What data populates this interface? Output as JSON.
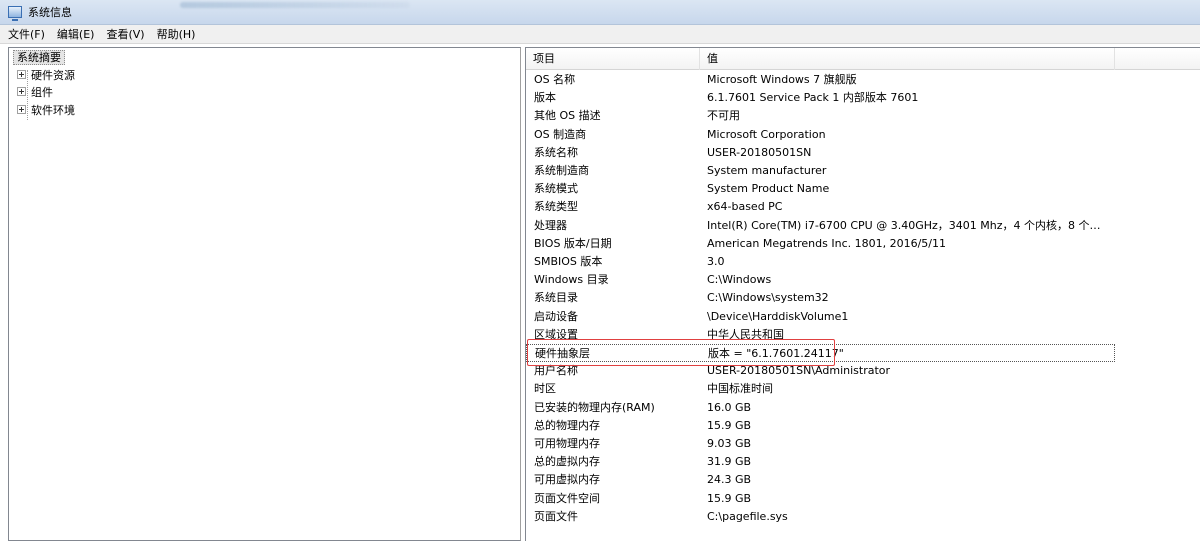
{
  "window": {
    "title": "系统信息"
  },
  "menu": [
    {
      "label": "文件(F)"
    },
    {
      "label": "编辑(E)"
    },
    {
      "label": "查看(V)"
    },
    {
      "label": "帮助(H)"
    }
  ],
  "tree": {
    "root": "系统摘要",
    "children": [
      {
        "label": "硬件资源"
      },
      {
        "label": "组件"
      },
      {
        "label": "软件环境"
      }
    ]
  },
  "list": {
    "columns": {
      "item": "项目",
      "value": "值"
    },
    "rows": [
      {
        "item": "OS 名称",
        "value": "Microsoft Windows 7 旗舰版"
      },
      {
        "item": "版本",
        "value": "6.1.7601 Service Pack 1 内部版本 7601"
      },
      {
        "item": "其他 OS 描述",
        "value": "不可用"
      },
      {
        "item": "OS 制造商",
        "value": "Microsoft Corporation"
      },
      {
        "item": "系统名称",
        "value": "USER-20180501SN"
      },
      {
        "item": "系统制造商",
        "value": "System manufacturer"
      },
      {
        "item": "系统模式",
        "value": "System Product Name"
      },
      {
        "item": "系统类型",
        "value": "x64-based PC"
      },
      {
        "item": "处理器",
        "value": "Intel(R) Core(TM) i7-6700 CPU @ 3.40GHz，3401 Mhz，4 个内核，8 个逻辑处理..."
      },
      {
        "item": "BIOS 版本/日期",
        "value": "American Megatrends Inc. 1801, 2016/5/11"
      },
      {
        "item": "SMBIOS 版本",
        "value": "3.0"
      },
      {
        "item": "Windows 目录",
        "value": "C:\\Windows"
      },
      {
        "item": "系统目录",
        "value": "C:\\Windows\\system32"
      },
      {
        "item": "启动设备",
        "value": "\\Device\\HarddiskVolume1"
      },
      {
        "item": "区域设置",
        "value": "中华人民共和国"
      },
      {
        "item": "硬件抽象层",
        "value": "版本 = \"6.1.7601.24117\""
      },
      {
        "item": "用户名称",
        "value": "USER-20180501SN\\Administrator"
      },
      {
        "item": "时区",
        "value": "中国标准时间"
      },
      {
        "item": "已安装的物理内存(RAM)",
        "value": "16.0 GB"
      },
      {
        "item": "总的物理内存",
        "value": "15.9 GB"
      },
      {
        "item": "可用物理内存",
        "value": "9.03 GB"
      },
      {
        "item": "总的虚拟内存",
        "value": "31.9 GB"
      },
      {
        "item": "可用虚拟内存",
        "value": "24.3 GB"
      },
      {
        "item": "页面文件空间",
        "value": "15.9 GB"
      },
      {
        "item": "页面文件",
        "value": "C:\\pagefile.sys"
      }
    ],
    "selected_row": "硬件抽象层"
  },
  "colors": {
    "highlight_box": "#e04040",
    "titlebar": "#c7d7ec"
  }
}
